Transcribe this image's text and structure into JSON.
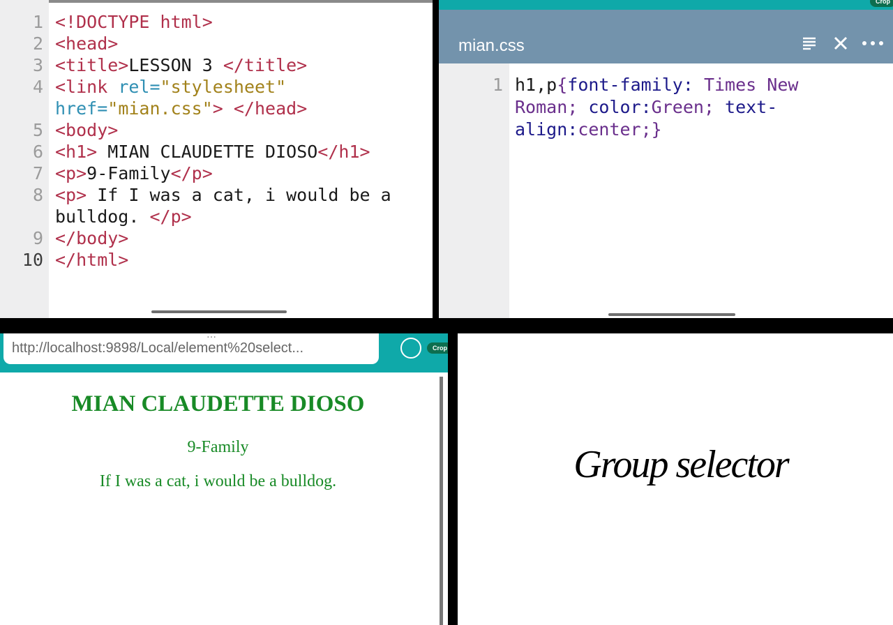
{
  "html_editor": {
    "lines": [
      {
        "n": "1",
        "parts": [
          {
            "t": "<!DOCTYPE html>",
            "c": "tag"
          }
        ]
      },
      {
        "n": "2",
        "parts": [
          {
            "t": "<head>",
            "c": "tag"
          }
        ]
      },
      {
        "n": "3",
        "parts": [
          {
            "t": "<title>",
            "c": "tag"
          },
          {
            "t": "LESSON 3 ",
            "c": "plain"
          },
          {
            "t": "</title>",
            "c": "tag"
          }
        ]
      },
      {
        "n": "4",
        "parts": [
          {
            "t": "<link ",
            "c": "tag"
          },
          {
            "t": "rel=",
            "c": "attr"
          },
          {
            "t": "\"stylesheet\"",
            "c": "str"
          }
        ]
      },
      {
        "n": "",
        "parts": [
          {
            "t": "href=",
            "c": "attr"
          },
          {
            "t": "\"mian.css\"",
            "c": "str"
          },
          {
            "t": "> </head>",
            "c": "tag"
          }
        ]
      },
      {
        "n": "5",
        "parts": [
          {
            "t": "<body>",
            "c": "tag"
          }
        ]
      },
      {
        "n": "6",
        "parts": [
          {
            "t": "<h1>",
            "c": "tag"
          },
          {
            "t": " MIAN CLAUDETTE DIOSO",
            "c": "plain"
          },
          {
            "t": "</h1>",
            "c": "tag"
          }
        ]
      },
      {
        "n": "7",
        "parts": [
          {
            "t": "<p>",
            "c": "tag"
          },
          {
            "t": "9-Family",
            "c": "plain"
          },
          {
            "t": "</p>",
            "c": "tag"
          }
        ]
      },
      {
        "n": "8",
        "parts": [
          {
            "t": "<p>",
            "c": "tag"
          },
          {
            "t": " If I was a cat, i would be a",
            "c": "plain"
          }
        ]
      },
      {
        "n": "",
        "parts": [
          {
            "t": "bulldog. ",
            "c": "plain"
          },
          {
            "t": "</p>",
            "c": "tag"
          }
        ]
      },
      {
        "n": "9",
        "parts": [
          {
            "t": "</body>",
            "c": "tag"
          }
        ]
      },
      {
        "n": "10",
        "parts": [
          {
            "t": "</html>",
            "c": "tag"
          }
        ]
      }
    ]
  },
  "css_editor": {
    "title": "mian.css",
    "icons": [
      "list-icon",
      "close-icon",
      "more-icon"
    ],
    "crop_label": "Crop",
    "lines": [
      {
        "n": "1",
        "parts": [
          {
            "t": "h1,p",
            "c": "plain"
          },
          {
            "t": "{",
            "c": "val"
          },
          {
            "t": "font-family:",
            "c": "kw"
          },
          {
            "t": " Times New",
            "c": "val"
          }
        ]
      },
      {
        "n": "",
        "parts": [
          {
            "t": "Roman; ",
            "c": "val"
          },
          {
            "t": "color:",
            "c": "kw"
          },
          {
            "t": "Green; ",
            "c": "val"
          },
          {
            "t": "text-",
            "c": "kw"
          }
        ]
      },
      {
        "n": "",
        "parts": [
          {
            "t": "align:",
            "c": "kw"
          },
          {
            "t": "center;}",
            "c": "val"
          }
        ]
      }
    ]
  },
  "browser": {
    "url": "http://localhost:9898/Local/element%20select...",
    "crop_label": "Crop",
    "heading": "MIAN CLAUDETTE DIOSO",
    "para1": "9-Family",
    "para2": "If I was a cat, i would be a bulldog."
  },
  "caption": {
    "text": "Group selector"
  },
  "colors": {
    "teal": "#0fa9a9",
    "css_header": "#7393ac",
    "rendered_green": "#188a26"
  }
}
